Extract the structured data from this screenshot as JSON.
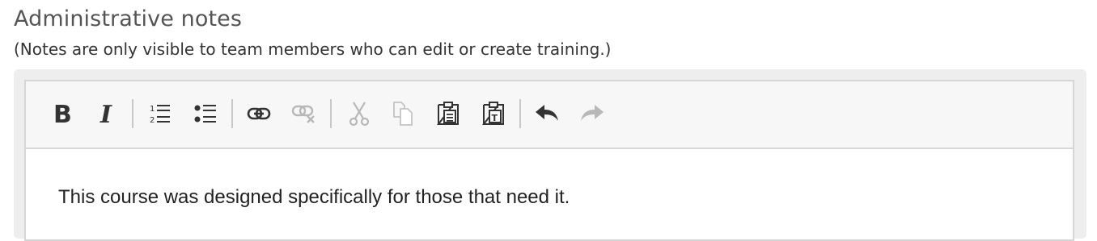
{
  "section": {
    "title": "Administrative notes",
    "subtitle": "(Notes are only visible to team members who can edit or create training.)"
  },
  "editor": {
    "toolbar": {
      "buttons": [
        {
          "icon": "bold-icon",
          "enabled": true
        },
        {
          "icon": "italic-icon",
          "enabled": true
        },
        {
          "icon": "numbered-list-icon",
          "enabled": true
        },
        {
          "icon": "bulleted-list-icon",
          "enabled": true
        },
        {
          "icon": "link-icon",
          "enabled": true
        },
        {
          "icon": "unlink-icon",
          "enabled": false
        },
        {
          "icon": "cut-icon",
          "enabled": false
        },
        {
          "icon": "copy-icon",
          "enabled": false
        },
        {
          "icon": "paste-icon",
          "enabled": true
        },
        {
          "icon": "paste-as-text-icon",
          "enabled": true
        },
        {
          "icon": "undo-icon",
          "enabled": true
        },
        {
          "icon": "redo-icon",
          "enabled": false
        }
      ]
    },
    "content": "This course was designed specifically for those that need it."
  },
  "colors": {
    "icon_active": "#333333",
    "icon_disabled": "#b8b8b8",
    "toolbar_bg": "#f7f7f7",
    "frame_bg": "#eeeeee"
  }
}
